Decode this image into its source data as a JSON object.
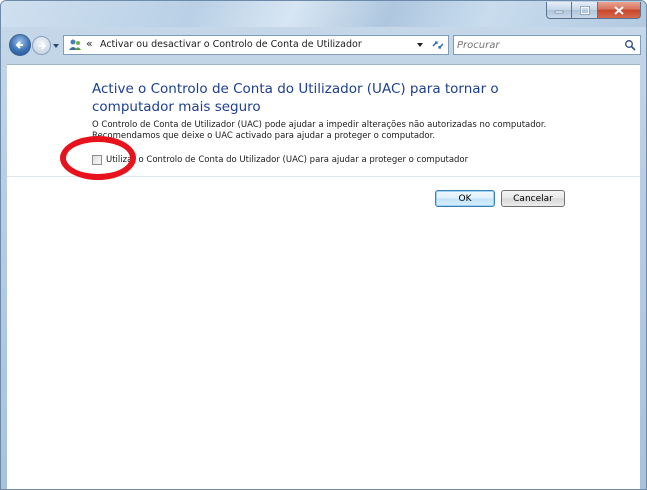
{
  "window": {
    "address_separator": "«",
    "address_path": "Activar ou desactivar o Controlo de Conta de Utilizador",
    "search_placeholder": "Procurar"
  },
  "content": {
    "heading": "Active o Controlo de Conta do Utilizador (UAC) para tornar o computador mais seguro",
    "description_line1": "O Controlo de Conta de Utilizador (UAC) pode ajudar a impedir alterações não autorizadas no computador.",
    "description_line2": "Recomendamos que deixe o UAC activado para ajudar a proteger o computador.",
    "checkbox_label": "Utilizar o Controlo de Conta do Utilizador (UAC) para ajudar a proteger o computador",
    "checkbox_checked": false
  },
  "buttons": {
    "ok_label": "OK",
    "cancel_label": "Cancelar"
  },
  "annotation": {
    "color": "#e8121d"
  },
  "icons": {
    "back": "back-arrow-icon",
    "forward": "forward-arrow-icon",
    "address": "user-accounts-icon",
    "refresh": "refresh-icon",
    "search": "search-icon"
  }
}
